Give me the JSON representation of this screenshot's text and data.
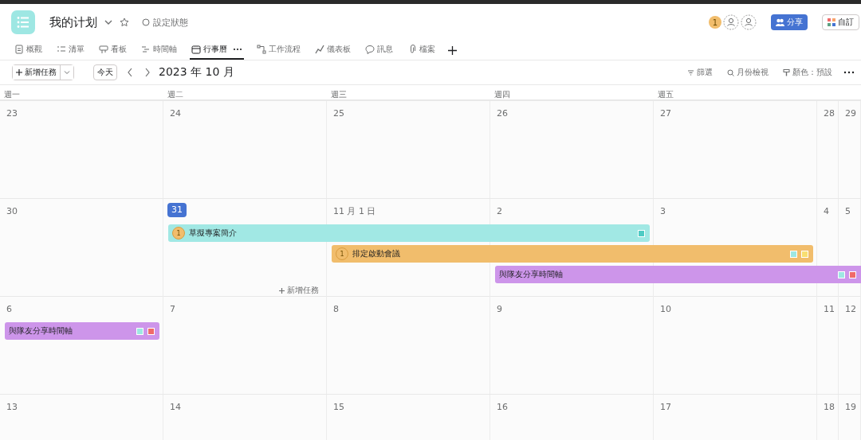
{
  "project": {
    "title": "我的计划",
    "status": "設定狀態"
  },
  "members": [
    {
      "kind": "count",
      "label": "1"
    },
    {
      "kind": "empty"
    },
    {
      "kind": "empty"
    }
  ],
  "actions": [
    {
      "kind": "share",
      "label": "分享"
    },
    {
      "kind": "customize",
      "label": "自訂"
    }
  ],
  "tabs": [
    {
      "label": "概觀",
      "selected": false
    },
    {
      "label": "清單",
      "selected": false
    },
    {
      "label": "看板",
      "selected": false
    },
    {
      "label": "時間軸",
      "selected": false
    },
    {
      "label": "行事曆",
      "selected": true
    },
    {
      "label": "工作流程",
      "selected": false
    },
    {
      "label": "儀表板",
      "selected": false
    },
    {
      "label": "訊息",
      "selected": false
    },
    {
      "label": "檔案",
      "selected": false
    }
  ],
  "toolbar": {
    "new_task": "新增任務",
    "today": "今天",
    "month": "2023 年 10 月",
    "filter": "篩選",
    "view": "月份檢視",
    "color_mode": "顏色：預設"
  },
  "weekdays": [
    "週一",
    "週二",
    "週三",
    "週四",
    "週五"
  ],
  "weeks": [
    {
      "days": [
        {
          "label": "23",
          "today": false
        },
        {
          "label": "24",
          "today": false
        },
        {
          "label": "25",
          "today": false
        },
        {
          "label": "26",
          "today": false
        },
        {
          "label": "27",
          "today": false
        },
        {
          "label": "28",
          "today": false
        },
        {
          "label": "29",
          "today": false
        }
      ]
    },
    {
      "days": [
        {
          "label": "30",
          "today": false
        },
        {
          "label": "31",
          "today": true
        },
        {
          "label": "11 月 1 日",
          "today": false
        },
        {
          "label": "2",
          "today": false
        },
        {
          "label": "3",
          "today": false
        },
        {
          "label": "4",
          "today": false
        },
        {
          "label": "5",
          "today": false
        }
      ],
      "events": [
        {
          "title": "草擬專案簡介",
          "assignee": "1",
          "color": "#a1e8e4",
          "covers": [
            false,
            true,
            true,
            true,
            false,
            false,
            false
          ],
          "tags": [
            {
              "color": "#4ecbc4"
            }
          ]
        },
        {
          "title": "排定啟動會議",
          "assignee": "1",
          "color": "#f1bd6c",
          "covers": [
            false,
            false,
            true,
            true,
            true,
            false,
            false
          ],
          "tags": [
            {
              "color": "#9ee7e3"
            },
            {
              "color": "#f8df72"
            }
          ]
        },
        {
          "title": "與隊友分享時間軸",
          "color": "#cd95ea",
          "covers": [
            false,
            false,
            false,
            true,
            true,
            true,
            true
          ],
          "tags": [
            {
              "color": "#9ee7e3"
            },
            {
              "color": "#f06a6a"
            }
          ]
        }
      ],
      "add_task": {
        "label": "新增任務"
      }
    },
    {
      "days": [
        {
          "label": "6",
          "today": false
        },
        {
          "label": "7",
          "today": false
        },
        {
          "label": "8",
          "today": false
        },
        {
          "label": "9",
          "today": false
        },
        {
          "label": "10",
          "today": false
        },
        {
          "label": "11",
          "today": false
        },
        {
          "label": "12",
          "today": false
        }
      ],
      "events": [
        {
          "title": "與隊友分享時間軸",
          "color": "#cd95ea",
          "covers": [
            true,
            false,
            false,
            false,
            false,
            false,
            false
          ],
          "tags": [
            {
              "color": "#9ee7e3"
            },
            {
              "color": "#f06a6a"
            }
          ]
        }
      ]
    },
    {
      "days": [
        {
          "label": "13",
          "today": false
        },
        {
          "label": "14",
          "today": false
        },
        {
          "label": "15",
          "today": false
        },
        {
          "label": "16",
          "today": false
        },
        {
          "label": "17",
          "today": false
        },
        {
          "label": "18",
          "today": false
        },
        {
          "label": "19",
          "today": false
        }
      ]
    }
  ]
}
